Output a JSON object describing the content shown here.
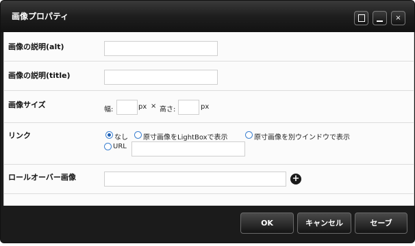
{
  "dialog": {
    "title": "画像プロパティ",
    "controls": {
      "maximize": "□",
      "minimize": "_",
      "close": "×"
    }
  },
  "fields": {
    "alt": {
      "label": "画像の説明(alt)",
      "value": ""
    },
    "title": {
      "label": "画像の説明(title)",
      "value": ""
    },
    "size": {
      "label": "画像サイズ",
      "width_label": "幅:",
      "width_value": "",
      "unit1": "px",
      "times": "×",
      "height_label": "高さ:",
      "height_value": "",
      "unit2": "px"
    },
    "link": {
      "label": "リンク",
      "options": [
        "なし",
        "原寸画像をLightBoxで表示",
        "原寸画像を別ウインドウで表示",
        "URL"
      ],
      "selected": "なし",
      "url_value": ""
    },
    "rollover": {
      "label": "ロールオーバー画像",
      "value": "",
      "add_icon": "plus-icon"
    }
  },
  "footer": {
    "ok": "OK",
    "cancel": "キャンセル",
    "save": "セーブ"
  },
  "colors": {
    "titlebar": "#1e1e1e",
    "content": "#fbfbfb",
    "radio_accent": "#1d5fb5"
  }
}
